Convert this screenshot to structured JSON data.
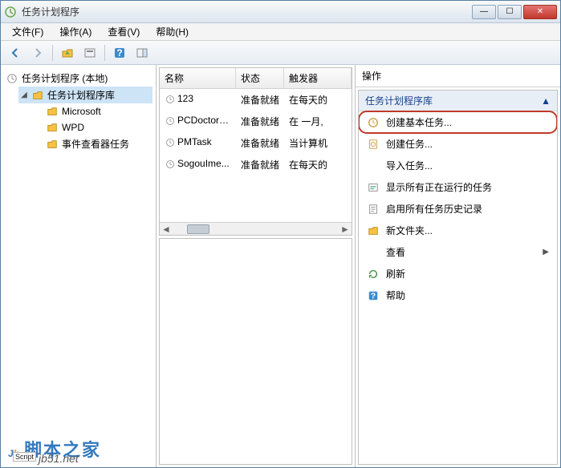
{
  "window": {
    "title": "任务计划程序"
  },
  "menus": {
    "file": "文件(F)",
    "action": "操作(A)",
    "view": "查看(V)",
    "help": "帮助(H)"
  },
  "tree": {
    "root": "任务计划程序 (本地)",
    "library": "任务计划程序库",
    "children": [
      {
        "label": "Microsoft"
      },
      {
        "label": "WPD"
      },
      {
        "label": "事件查看器任务"
      }
    ]
  },
  "list": {
    "columns": {
      "name": "名称",
      "status": "状态",
      "trigger": "触发器"
    },
    "rows": [
      {
        "name": "123",
        "status": "准备就绪",
        "trigger": "在每天的"
      },
      {
        "name": "PCDoctorB...",
        "status": "准备就绪",
        "trigger": "在 一月, "
      },
      {
        "name": "PMTask",
        "status": "准备就绪",
        "trigger": "当计算机"
      },
      {
        "name": "SogouIme...",
        "status": "准备就绪",
        "trigger": "在每天的"
      }
    ]
  },
  "actions": {
    "title": "操作",
    "group": "任务计划程序库",
    "items": [
      {
        "icon": "clock",
        "label": "创建基本任务...",
        "highlight": true
      },
      {
        "icon": "task",
        "label": "创建任务..."
      },
      {
        "icon": "none",
        "label": "导入任务..."
      },
      {
        "icon": "running",
        "label": "显示所有正在运行的任务"
      },
      {
        "icon": "history",
        "label": "启用所有任务历史记录"
      },
      {
        "icon": "folder",
        "label": "新文件夹..."
      },
      {
        "icon": "none",
        "label": "查看",
        "submenu": true
      },
      {
        "icon": "refresh",
        "label": "刷新"
      },
      {
        "icon": "help",
        "label": "帮助"
      }
    ]
  },
  "watermark": {
    "brand1": "J",
    "brand2": "b",
    "text": "脚本之家",
    "url": "jb51.net",
    "script": "Script"
  }
}
